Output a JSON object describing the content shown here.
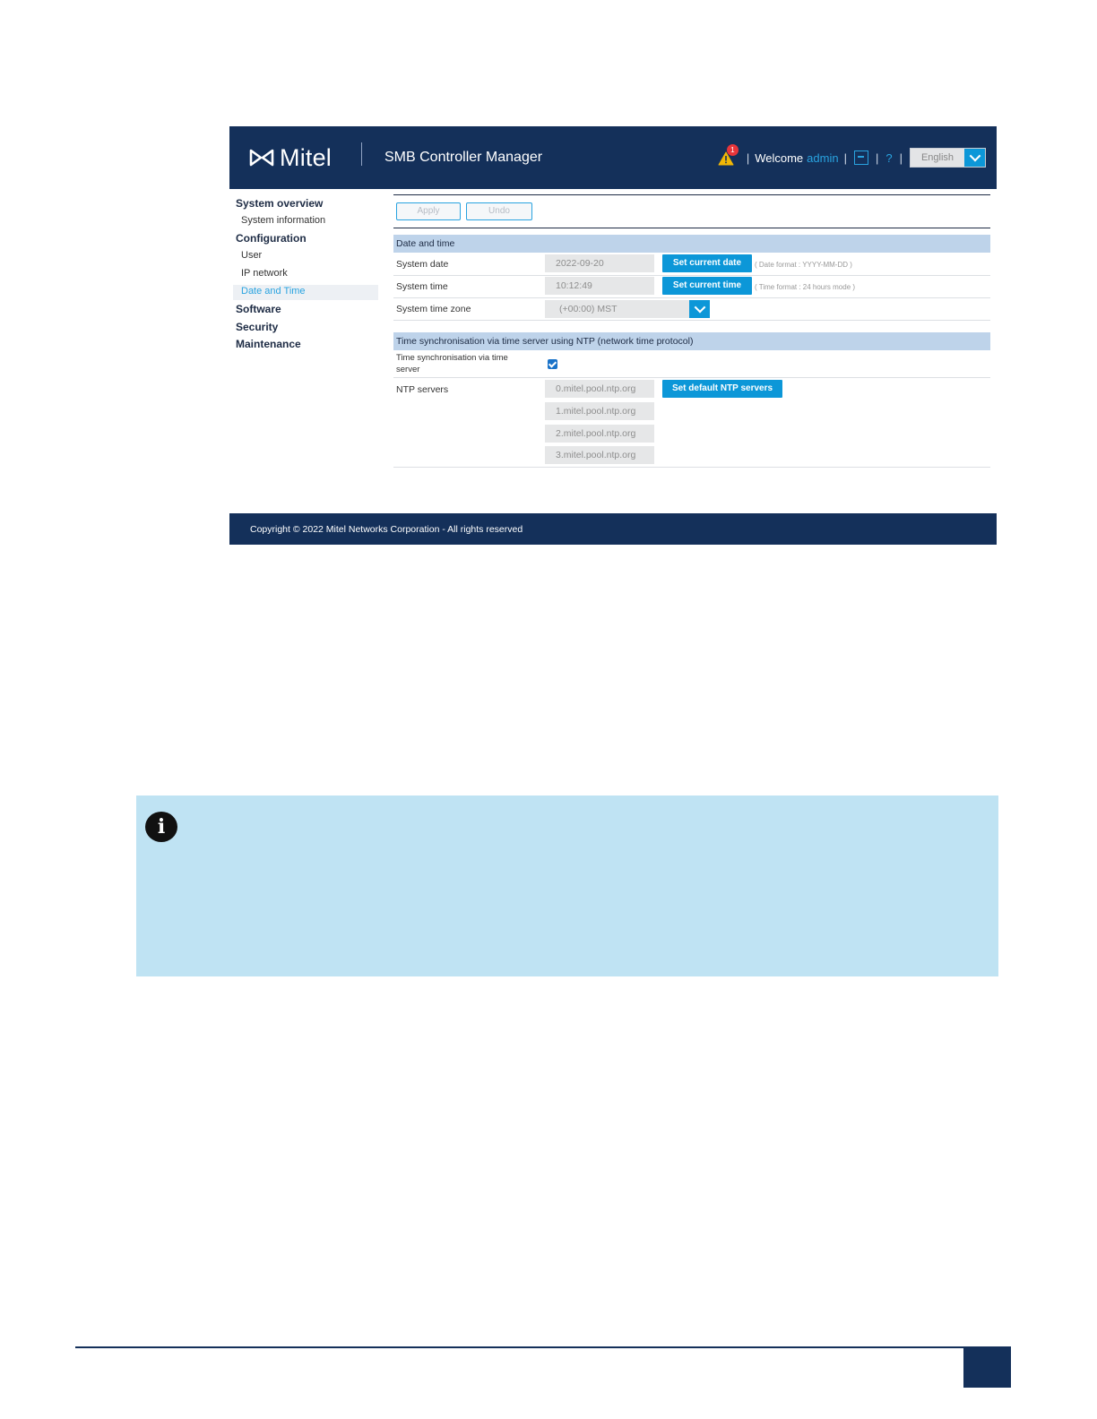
{
  "header": {
    "logo_text": "Mitel",
    "app_title": "SMB Controller Manager",
    "alert_count": "1",
    "welcome_label": "Welcome",
    "user": "admin",
    "separator": "|",
    "help": "?",
    "language": "English"
  },
  "sidebar": {
    "items": [
      {
        "label": "System overview",
        "type": "head"
      },
      {
        "label": "System information",
        "type": "sub"
      },
      {
        "label": "Configuration",
        "type": "head"
      },
      {
        "label": "User",
        "type": "sub"
      },
      {
        "label": "IP network",
        "type": "sub"
      },
      {
        "label": "Date and Time",
        "type": "sub",
        "active": true
      },
      {
        "label": "Software",
        "type": "head"
      },
      {
        "label": "Security",
        "type": "head"
      },
      {
        "label": "Maintenance",
        "type": "head"
      }
    ]
  },
  "toolbar": {
    "apply_label": "Apply",
    "undo_label": "Undo"
  },
  "date_time": {
    "title": "Date and time",
    "system_date_label": "System date",
    "system_date_value": "2022-09-20",
    "set_date_label": "Set current date",
    "date_hint": "( Date format : YYYY-MM-DD )",
    "system_time_label": "System time",
    "system_time_value": "10:12:49",
    "set_time_label": "Set current time",
    "time_hint": "( Time format : 24 hours mode )",
    "time_zone_label": "System time zone",
    "time_zone_value": "(+00:00) MST"
  },
  "ntp": {
    "title": "Time synchronisation via time server using NTP (network time protocol)",
    "sync_label_line1": "Time synchronisation via time",
    "sync_label_line2": "server",
    "sync_enabled": true,
    "servers_label": "NTP servers",
    "servers": [
      "0.mitel.pool.ntp.org",
      "1.mitel.pool.ntp.org",
      "2.mitel.pool.ntp.org",
      "3.mitel.pool.ntp.org"
    ],
    "default_button_label": "Set default NTP servers"
  },
  "footer": {
    "copyright": "Copyright © 2022 Mitel Networks Corporation - All rights reserved"
  },
  "note": {
    "icon": "info-icon",
    "icon_glyph": "i"
  },
  "colors": {
    "navy": "#14305a",
    "accent": "#0c97d8",
    "link": "#29a3e0",
    "section": "#bed3ea",
    "note_bg": "#bfe3f3"
  }
}
